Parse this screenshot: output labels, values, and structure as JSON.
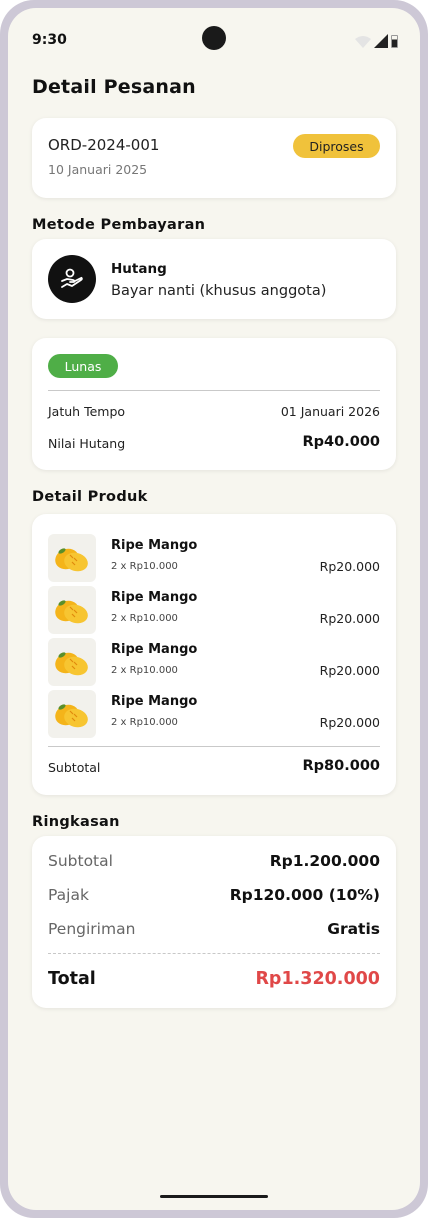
{
  "status_bar": {
    "time": "9:30"
  },
  "page": {
    "title": "Detail Pesanan"
  },
  "order": {
    "id": "ORD-2024-001",
    "date": "10 Januari 2025",
    "status": "Diproses"
  },
  "payment": {
    "section_title": "Metode Pembayaran",
    "method_name": "Hutang",
    "method_desc": "Bayar nanti (khusus anggota)",
    "icon": "hand-coin-icon"
  },
  "debt": {
    "status": "Lunas",
    "due_label": "Jatuh Tempo",
    "due_value": "01 Januari 2026",
    "amount_label": "Nilai Hutang",
    "amount_value": "Rp40.000"
  },
  "products": {
    "section_title": "Detail Produk",
    "items": [
      {
        "name": "Ripe Mango",
        "qty": "2 x Rp10.000",
        "price": "Rp20.000"
      },
      {
        "name": "Ripe Mango",
        "qty": "2 x Rp10.000",
        "price": "Rp20.000"
      },
      {
        "name": "Ripe Mango",
        "qty": "2 x Rp10.000",
        "price": "Rp20.000"
      },
      {
        "name": "Ripe Mango",
        "qty": "2 x Rp10.000",
        "price": "Rp20.000"
      }
    ],
    "subtotal_label": "Subtotal",
    "subtotal_value": "Rp80.000"
  },
  "summary": {
    "section_title": "Ringkasan",
    "subtotal_label": "Subtotal",
    "subtotal_value": "Rp1.200.000",
    "tax_label": "Pajak",
    "tax_value": "Rp120.000 (10%)",
    "shipping_label": "Pengiriman",
    "shipping_value": "Gratis",
    "total_label": "Total",
    "total_value": "Rp1.320.000"
  },
  "colors": {
    "status_processing": "#f0c23b",
    "status_paid": "#4fae47",
    "total_accent": "#e04848",
    "background": "#f7f6ef"
  }
}
